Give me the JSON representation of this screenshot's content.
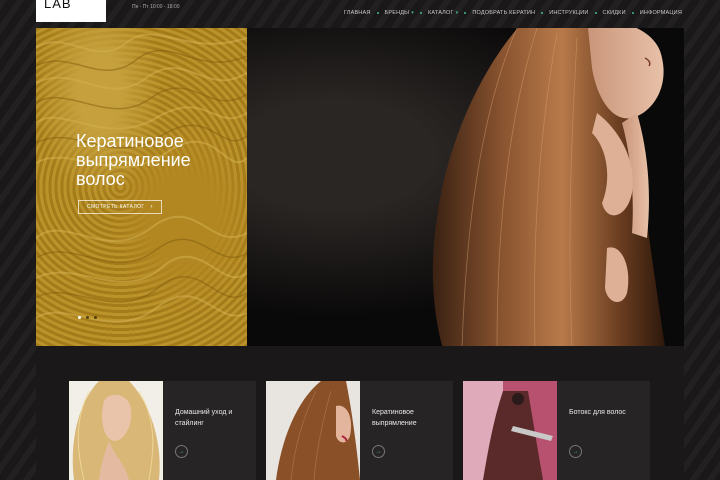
{
  "header": {
    "logo": "LAB",
    "hours": "Пн - Пт 10:00 - 18:00",
    "nav": [
      {
        "label": "Главная",
        "dropdown": false
      },
      {
        "label": "Бренды",
        "dropdown": true
      },
      {
        "label": "Каталог",
        "dropdown": true
      },
      {
        "label": "Подобрать кератин",
        "dropdown": false
      },
      {
        "label": "Инструкции",
        "dropdown": false
      },
      {
        "label": "Скидки",
        "dropdown": false
      },
      {
        "label": "Информация",
        "dropdown": false
      }
    ]
  },
  "hero": {
    "title": "Кератиновое выпрямление волос",
    "button_label": "Смотреть каталог",
    "slide_count": 3,
    "active_slide": 1
  },
  "cards": [
    {
      "label": "Домашний уход и стайлинг"
    },
    {
      "label": "Кератиновое выпрямление"
    },
    {
      "label": "Ботокс для волос"
    }
  ],
  "colors": {
    "accent": "#3fb99b",
    "background": "#1c1a1a",
    "hero_gold": "#c89b2a"
  }
}
